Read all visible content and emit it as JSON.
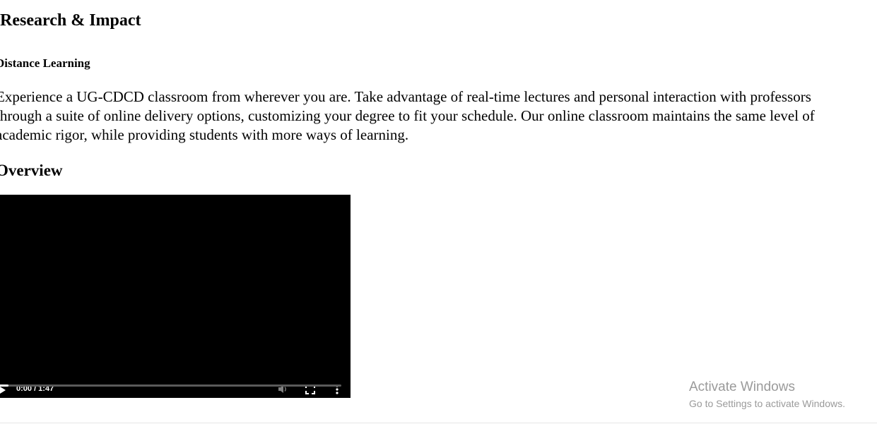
{
  "section": {
    "title": "Research & Impact"
  },
  "program": {
    "title": "Distance Learning",
    "description": "Experience a UG-CDCD classroom from wherever you are. Take advantage of real-time lectures and personal interaction with professors through a suite of online delivery options, customizing your degree to fit your schedule. Our online classroom maintains the same level of academic rigor, while providing students with more ways of learning."
  },
  "overview": {
    "heading": "Overview"
  },
  "video": {
    "time_display": "0:00 / 1:47",
    "progress_fraction": 0.03,
    "controls": {
      "play_icon": "play-icon",
      "volume_icon": "volume-icon",
      "fullscreen_icon": "fullscreen-icon",
      "more_icon": "more-vertical-icon"
    }
  },
  "watermark": {
    "line1": "Activate Windows",
    "line2": "Go to Settings to activate Windows."
  },
  "colors": {
    "text": "#000000",
    "video_bg": "#000000",
    "watermark": "#9a9a9a"
  }
}
